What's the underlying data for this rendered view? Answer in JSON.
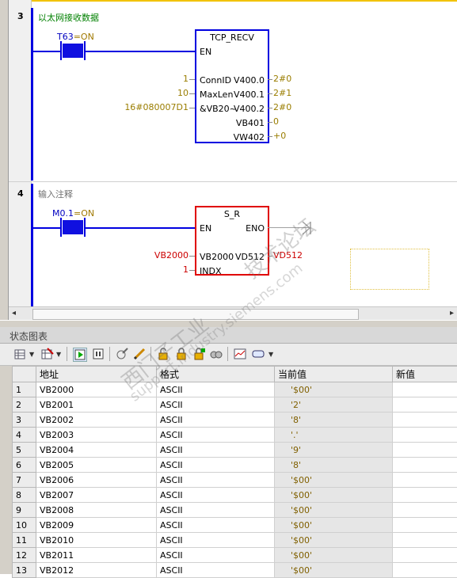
{
  "networks": [
    {
      "number": "3",
      "comment": "以太网接收数据",
      "contact": {
        "address": "T63",
        "state": "=ON"
      },
      "block": {
        "title": "TCP_RECV",
        "en": "EN",
        "inputs": [
          {
            "value": "1",
            "pin": "ConnID"
          },
          {
            "value": "10",
            "pin": "MaxLen"
          },
          {
            "value": "16#080007D1",
            "pin": "&VB20~"
          }
        ],
        "outputs": [
          {
            "pin": "V400.0",
            "value": "2#0"
          },
          {
            "pin": "V400.1",
            "value": "2#1"
          },
          {
            "pin": "V400.2",
            "value": "2#0"
          },
          {
            "pin": "VB401",
            "value": "0"
          },
          {
            "pin": "VW402",
            "value": "+0"
          }
        ]
      }
    },
    {
      "number": "4",
      "comment": "输入注释",
      "contact": {
        "address": "M0.1",
        "state": "=ON"
      },
      "block": {
        "title": "S_R",
        "en": "EN",
        "eno": "ENO",
        "inputs": [
          {
            "value": "VB2000",
            "pin": "VB2000"
          },
          {
            "value": "1",
            "pin": "INDX"
          }
        ],
        "outputs": [
          {
            "pin": "VD512",
            "value": "VD512"
          }
        ]
      }
    }
  ],
  "status_chart": {
    "title": "状态图表",
    "columns": [
      "地址",
      "格式",
      "当前值",
      "新值"
    ],
    "rows": [
      {
        "n": "1",
        "address": "VB2000",
        "format": "ASCII",
        "current": "'$00'",
        "new": ""
      },
      {
        "n": "2",
        "address": "VB2001",
        "format": "ASCII",
        "current": "'2'",
        "new": ""
      },
      {
        "n": "3",
        "address": "VB2002",
        "format": "ASCII",
        "current": "'8'",
        "new": ""
      },
      {
        "n": "4",
        "address": "VB2003",
        "format": "ASCII",
        "current": "'.'",
        "new": ""
      },
      {
        "n": "5",
        "address": "VB2004",
        "format": "ASCII",
        "current": "'9'",
        "new": ""
      },
      {
        "n": "6",
        "address": "VB2005",
        "format": "ASCII",
        "current": "'8'",
        "new": ""
      },
      {
        "n": "7",
        "address": "VB2006",
        "format": "ASCII",
        "current": "'$00'",
        "new": ""
      },
      {
        "n": "8",
        "address": "VB2007",
        "format": "ASCII",
        "current": "'$00'",
        "new": ""
      },
      {
        "n": "9",
        "address": "VB2008",
        "format": "ASCII",
        "current": "'$00'",
        "new": ""
      },
      {
        "n": "10",
        "address": "VB2009",
        "format": "ASCII",
        "current": "'$00'",
        "new": ""
      },
      {
        "n": "11",
        "address": "VB2010",
        "format": "ASCII",
        "current": "'$00'",
        "new": ""
      },
      {
        "n": "12",
        "address": "VB2011",
        "format": "ASCII",
        "current": "'$00'",
        "new": ""
      },
      {
        "n": "13",
        "address": "VB2012",
        "format": "ASCII",
        "current": "'$00'",
        "new": ""
      }
    ]
  },
  "toolbar_icons": [
    "add-row-icon",
    "delete-row-icon",
    "run-status-icon",
    "stop-status-icon",
    "write-icon",
    "pencil-icon",
    "unlock-icon",
    "lock-icon",
    "force-icon",
    "unforce-icon",
    "trend-icon",
    "format-icon"
  ],
  "watermark": {
    "line1": "西门子工业",
    "line2": "support.industry.siemens.com",
    "line3": "技术论坛"
  },
  "colors": {
    "wire": "#0000e0",
    "active_block": "#e00000",
    "monitor_value": "#9a7d00"
  }
}
